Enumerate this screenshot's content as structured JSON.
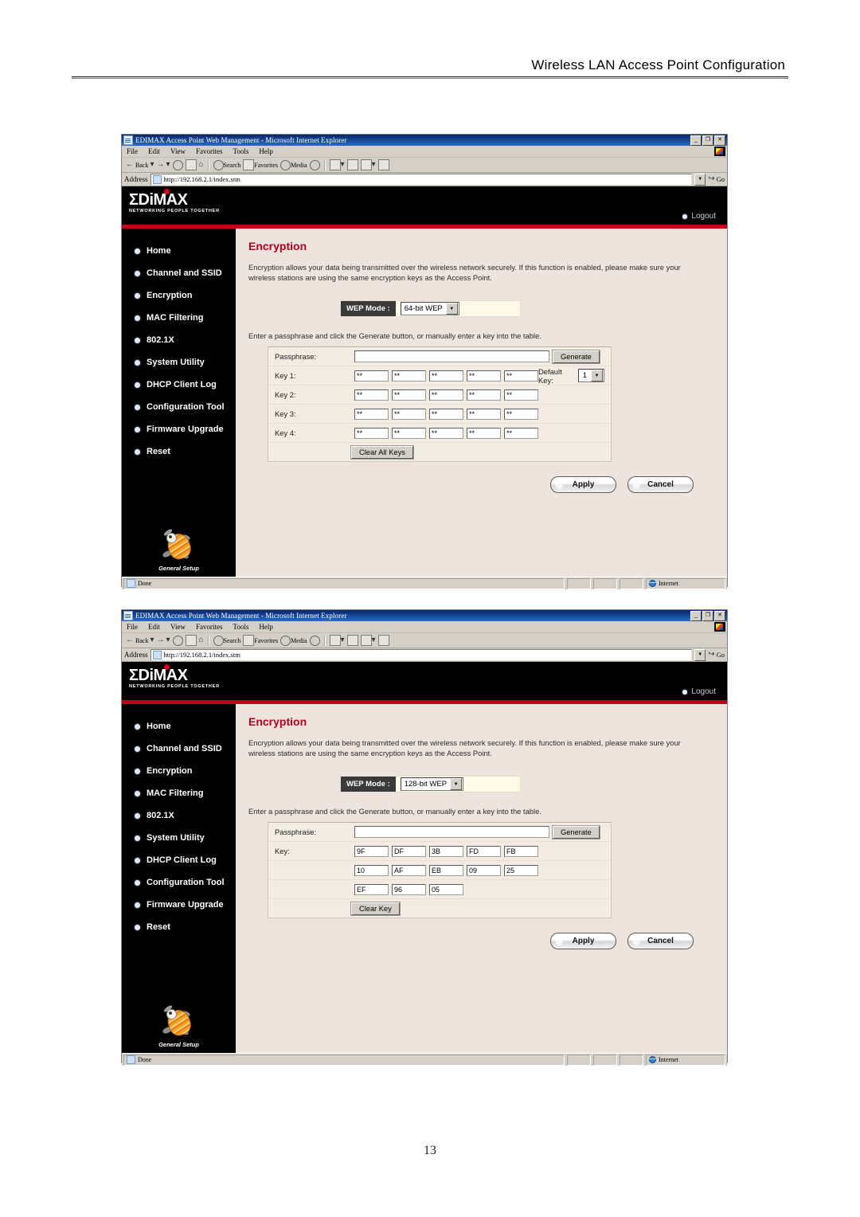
{
  "document": {
    "header_title": "Wireless LAN Access Point Configuration",
    "page_number": "13"
  },
  "browser": {
    "window_title": "EDIMAX Access Point Web Management - Microsoft Internet Explorer",
    "window_controls": {
      "minimize": "_",
      "restore": "❐",
      "close": "✕"
    },
    "menus": [
      "File",
      "Edit",
      "View",
      "Favorites",
      "Tools",
      "Help"
    ],
    "toolbar": {
      "back": "Back",
      "forward": "",
      "stop": "",
      "refresh": "",
      "home": "",
      "search": "Search",
      "favorites": "Favorites",
      "media": "Media",
      "history": "",
      "mail": "",
      "print": "",
      "edit": "",
      "discuss": ""
    },
    "address": {
      "label": "Address",
      "value": "http://192.168.2.1/index.stm",
      "go_label": "Go"
    },
    "status": {
      "text": "Done",
      "zone": "Internet"
    }
  },
  "app": {
    "logo_word": "ΣDiMAX",
    "logo_tagline": "NETWORKING PEOPLE TOGETHER",
    "logout_label": "Logout",
    "sidebar_footer_caption": "General Setup",
    "nav_items": [
      "Home",
      "Channel and SSID",
      "Encryption",
      "MAC Filtering",
      "802.1X",
      "System Utility",
      "DHCP Client Log",
      "Configuration Tool",
      "Firmware Upgrade",
      "Reset"
    ],
    "accent_red": "#c00018",
    "heading_red": "#b8001f"
  },
  "screens": [
    {
      "heading": "Encryption",
      "description": "Encryption allows your data being transmitted over the wireless network securely. If this function is enabled, please make sure your wireless stations are using the same encryption keys as the Access Point.",
      "wep_mode_label": "WEP Mode :",
      "wep_mode_value": "64-bit WEP",
      "hint": "Enter a passphrase and click the Generate button, or manually enter a key into the table.",
      "passphrase_label": "Passphrase:",
      "passphrase_value": "",
      "generate_label": "Generate",
      "default_key_label": "Default Key:",
      "default_key_value": "1",
      "clear_label": "Clear All Keys",
      "key_rows": [
        {
          "label": "Key 1:",
          "cells": [
            "**",
            "**",
            "**",
            "**",
            "**"
          ]
        },
        {
          "label": "Key 2:",
          "cells": [
            "**",
            "**",
            "**",
            "**",
            "**"
          ]
        },
        {
          "label": "Key 3:",
          "cells": [
            "**",
            "**",
            "**",
            "**",
            "**"
          ]
        },
        {
          "label": "Key 4:",
          "cells": [
            "**",
            "**",
            "**",
            "**",
            "**"
          ]
        }
      ],
      "apply_label": "Apply",
      "cancel_label": "Cancel"
    },
    {
      "heading": "Encryption",
      "description": "Encryption allows your data being transmitted over the wireless network securely. If this function is enabled, please make sure your wireless stations are using the same encryption keys as the Access Point.",
      "wep_mode_label": "WEP Mode :",
      "wep_mode_value": "128-bit WEP",
      "hint": "Enter a passphrase and click the Generate button, or manually enter a key into the table.",
      "passphrase_label": "Passphrase:",
      "passphrase_value": "",
      "generate_label": "Generate",
      "clear_label": "Clear Key",
      "key_rows": [
        {
          "label": "Key:",
          "cells": [
            "9F",
            "DF",
            "3B",
            "FD",
            "FB"
          ]
        },
        {
          "label": "",
          "cells": [
            "10",
            "AF",
            "EB",
            "09",
            "25"
          ]
        },
        {
          "label": "",
          "cells": [
            "EF",
            "96",
            "05"
          ]
        }
      ],
      "apply_label": "Apply",
      "cancel_label": "Cancel"
    }
  ]
}
